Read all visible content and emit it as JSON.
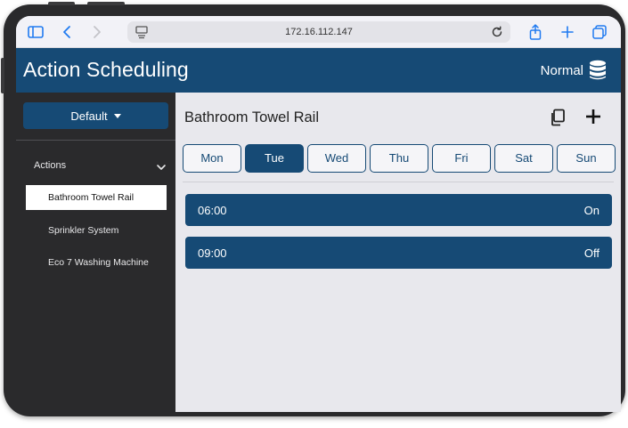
{
  "browser": {
    "url": "172.16.112.147"
  },
  "header": {
    "title": "Action Scheduling",
    "mode": "Normal"
  },
  "sidebar": {
    "profile_label": "Default",
    "section_label": "Actions",
    "items": [
      {
        "label": "Bathroom Towel Rail",
        "selected": true
      },
      {
        "label": "Sprinkler System",
        "selected": false
      },
      {
        "label": "Eco 7 Washing Machine",
        "selected": false
      }
    ]
  },
  "main": {
    "title": "Bathroom Towel Rail",
    "days": [
      "Mon",
      "Tue",
      "Wed",
      "Thu",
      "Fri",
      "Sat",
      "Sun"
    ],
    "active_day": "Tue",
    "schedule": [
      {
        "time": "06:00",
        "state": "On"
      },
      {
        "time": "09:00",
        "state": "Off"
      }
    ]
  },
  "colors": {
    "brand": "#164a75",
    "sidebar_bg": "#2a2a2c",
    "browser_accent": "#1f7af0"
  }
}
